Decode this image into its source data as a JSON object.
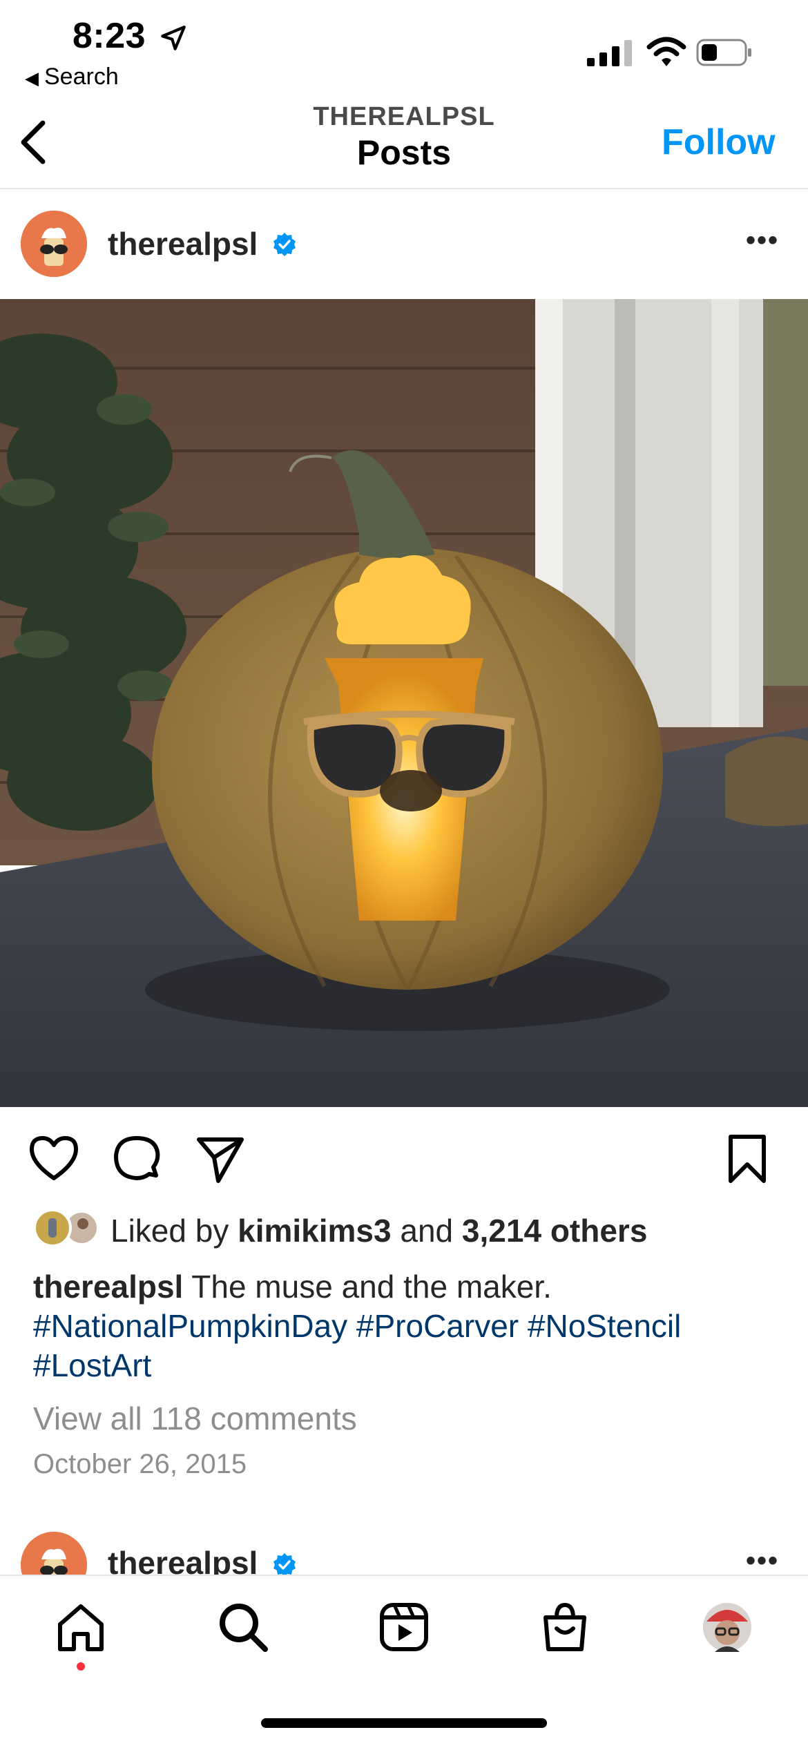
{
  "status_bar": {
    "time": "8:23",
    "back_app": "Search"
  },
  "header": {
    "account": "THEREALPSL",
    "title": "Posts",
    "follow_label": "Follow"
  },
  "post": {
    "username": "therealpsl",
    "likes": {
      "prefix": "Liked by ",
      "liker": "kimikims3",
      "middle": " and ",
      "others": "3,214 others"
    },
    "caption": {
      "username": "therealpsl",
      "text": " The muse and the maker.",
      "hashtags": [
        "#NationalPumpkinDay",
        "#ProCarver",
        "#NoStencil",
        "#LostArt"
      ]
    },
    "view_comments": "View all 118 comments",
    "date": "October 26, 2015"
  },
  "next_post": {
    "username": "therealpsl"
  },
  "nav": {
    "items": [
      "home-icon",
      "search-icon",
      "reels-icon",
      "shop-icon",
      "profile-avatar"
    ]
  },
  "colors": {
    "accent": "#0095f6",
    "hashtag": "#00376b",
    "verified": "#0095f6",
    "muted": "#8e8e8e",
    "notification_dot": "#ff3040"
  }
}
